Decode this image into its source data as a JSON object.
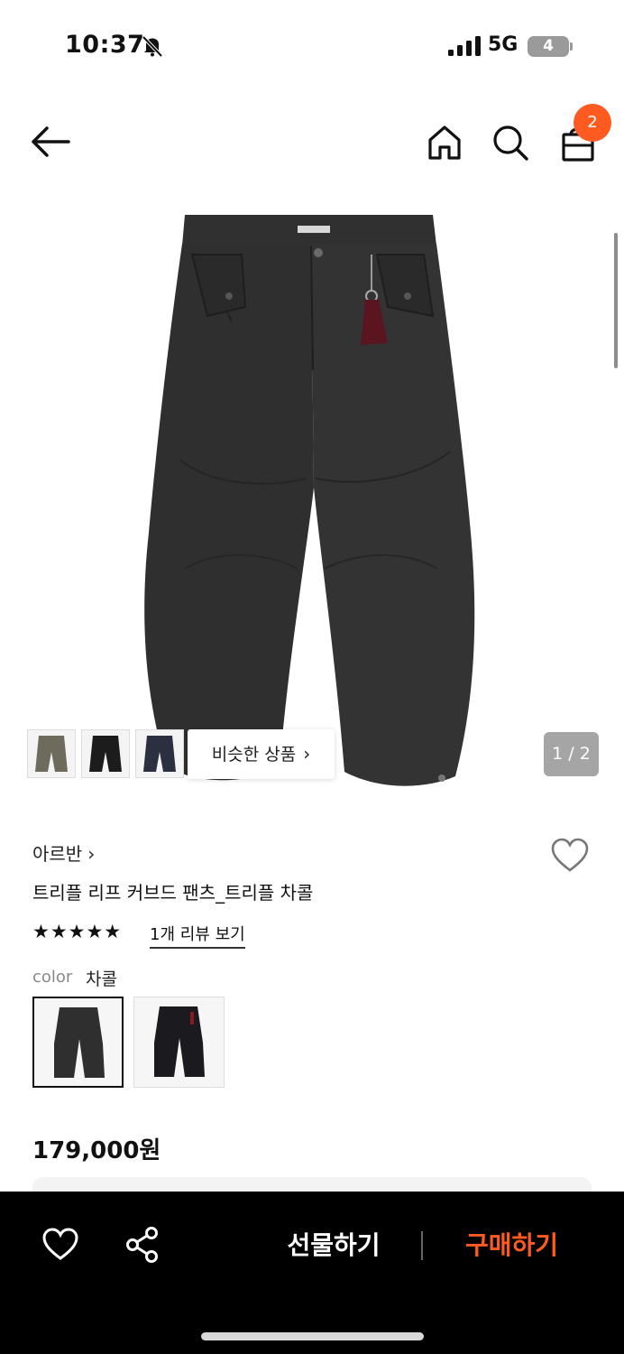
{
  "status_bar": {
    "time": "10:37",
    "network": "5G",
    "battery": "4",
    "icons": [
      "bell-off-icon",
      "signal-icon",
      "battery-icon"
    ]
  },
  "nav": {
    "icons": [
      "back-arrow-icon",
      "home-icon",
      "search-icon",
      "shopping-bag-icon"
    ],
    "bag_badge": "2"
  },
  "gallery": {
    "similar_label": "비슷한 상품",
    "page_counter": "1 / 2",
    "thumbnail_colors": [
      "#6e6a5c",
      "#1c1c1c",
      "#2b3040"
    ]
  },
  "product": {
    "brand": "아르반",
    "title": "트리플 리프 커브드 팬츠_트리플 차콜",
    "stars": "★★★★★",
    "rating": 5,
    "review_link": "1개 리뷰 보기",
    "color_label": "color",
    "color_value": "차콜",
    "swatches": [
      "charcoal",
      "black"
    ],
    "price": "179,000원"
  },
  "bottom_bar": {
    "gift_label": "선물하기",
    "buy_label": "구매하기",
    "icons": [
      "heart-icon",
      "share-icon"
    ]
  },
  "colors": {
    "accent": "#ff5a1f",
    "bottom_bar": "#000000",
    "pants": "#2f2f2f"
  }
}
